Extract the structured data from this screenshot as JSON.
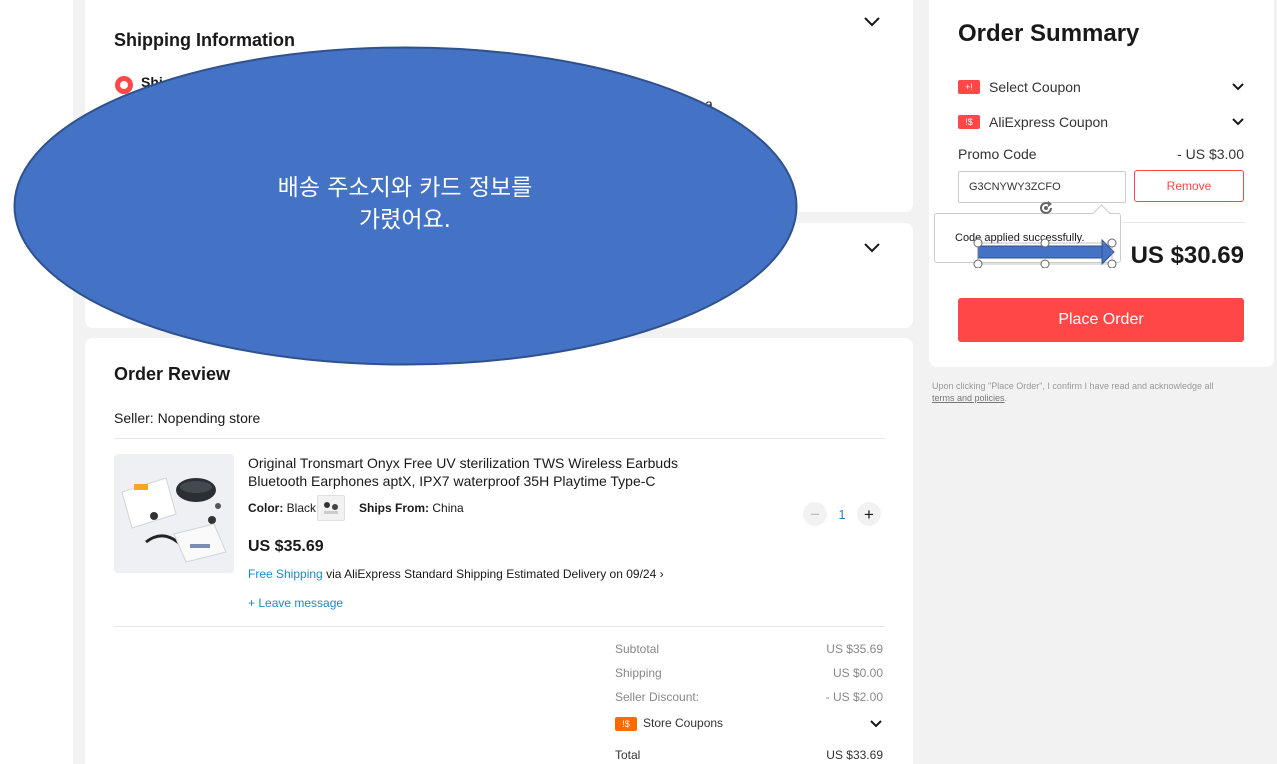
{
  "shipping": {
    "title": "Shipping Information",
    "address_prefix": "Shi",
    "address_tail": "a"
  },
  "review": {
    "title": "Order Review",
    "seller": "Seller: Nopending store",
    "product": {
      "title": "Original Tronsmart Onyx Free UV sterilization TWS Wireless Earbuds Bluetooth Earphones aptX, IPX7 waterproof 35H Playtime Type-C",
      "color_label": "Color:",
      "color_value": "Black",
      "ships_label": "Ships From:",
      "ships_value": "China",
      "price": "US $35.69",
      "free_shipping": "Free Shipping",
      "via": "via AliExpress Standard Shipping",
      "estimated": "Estimated Delivery on 09/24",
      "quantity": "1",
      "leave_message": "Leave message"
    },
    "totals": {
      "subtotal_label": "Subtotal",
      "subtotal_value": "US $35.69",
      "shipping_label": "Shipping",
      "shipping_value": "US $0.00",
      "seller_discount_label": "Seller Discount:",
      "seller_discount_value": "- US $2.00",
      "store_coupons_label": "Store Coupons",
      "total_label": "Total",
      "total_value": "US $33.69"
    }
  },
  "summary": {
    "title": "Order Summary",
    "select_coupon": "Select Coupon",
    "aliexpress_coupon": "AliExpress Coupon",
    "promo_label": "Promo Code",
    "promo_discount": "- US $3.00",
    "promo_code": "G3CNYWY3ZCFO",
    "remove": "Remove",
    "total": "US $30.69",
    "place_order": "Place Order",
    "tooltip": "Code applied successfully."
  },
  "terms": {
    "text": "Upon clicking \"Place Order\", I confirm I have read and acknowledge all",
    "link": "terms and policies"
  },
  "overlay": {
    "line1": "배송 주소지와 카드 정보를",
    "line2": "가렸어요."
  },
  "colors": {
    "accent": "#ff4747",
    "link": "#1a8bc8",
    "overlay_fill": "#4472c4",
    "overlay_stroke": "#2f528f"
  }
}
